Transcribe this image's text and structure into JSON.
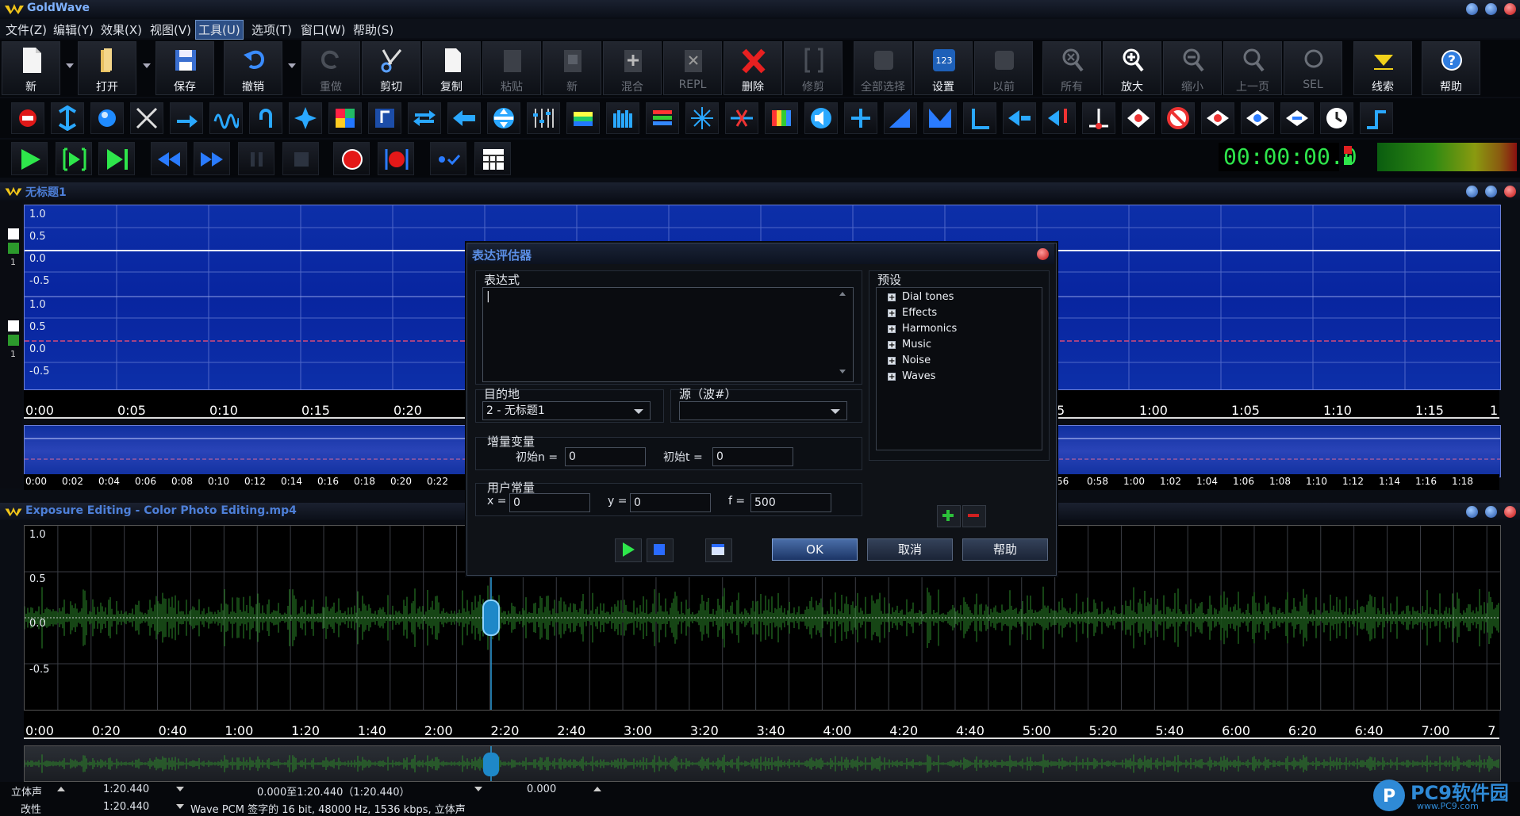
{
  "app": {
    "title": "GoldWave"
  },
  "menu": [
    "文件(Z)",
    "编辑(Y)",
    "效果(X)",
    "视图(V)",
    "工具(U)",
    "选项(T)",
    "窗口(W)",
    "帮助(S)"
  ],
  "toolbar": {
    "new": "新",
    "open": "打开",
    "save": "保存",
    "undo": "撤销",
    "redo": "重做",
    "cut": "剪切",
    "copy": "复制",
    "paste": "粘贴",
    "paste_new": "新",
    "mix": "混合",
    "replace": "REPL",
    "delete": "删除",
    "trim": "修剪",
    "select_all": "全部选择",
    "settings": "设置",
    "previous": "以前",
    "all": "所有",
    "zoom_in": "放大",
    "zoom_out": "缩小",
    "prev_page": "上一页",
    "sel": "SEL",
    "cue": "线索",
    "help": "帮助",
    "settings_badge": "123"
  },
  "transport": {
    "time": "00:00:00.0"
  },
  "wave1": {
    "title": "无标题1",
    "y_labels": [
      "1.0",
      "0.5",
      "0.0",
      "-0.5"
    ],
    "ch_num": "1",
    "time_ticks": [
      "0:00",
      "0:05",
      "0:10",
      "0:15",
      "0:20",
      "5",
      "1:00",
      "1:05",
      "1:10",
      "1:15",
      "1"
    ],
    "overview_ticks": [
      "0:00",
      "0:02",
      "0:04",
      "0:06",
      "0:08",
      "0:10",
      "0:12",
      "0:14",
      "0:16",
      "0:18",
      "0:20",
      "0:22",
      ":56",
      "0:58",
      "1:00",
      "1:02",
      "1:04",
      "1:06",
      "1:08",
      "1:10",
      "1:12",
      "1:14",
      "1:16",
      "1:18"
    ]
  },
  "wave2": {
    "title": "Exposure Editing - Color Photo Editing.mp4",
    "y_labels": [
      "1.0",
      "0.5",
      "0.0",
      "-0.5"
    ],
    "time_ticks": [
      "0:00",
      "0:20",
      "0:40",
      "1:00",
      "1:20",
      "1:40",
      "2:00",
      "2:20",
      "2:40",
      "3:00",
      "3:20",
      "3:40",
      "4:00",
      "4:20",
      "4:40",
      "5:00",
      "5:20",
      "5:40",
      "6:00",
      "6:20",
      "6:40",
      "7:00",
      "7"
    ]
  },
  "dialog": {
    "title": "表达评估器",
    "expression_label": "表达式",
    "expression_value": "|",
    "destination_label": "目的地",
    "destination_value": "2 - 无标题1",
    "source_label": "源（波#）",
    "source_value": "",
    "increment_label": "增量变量",
    "init_n_label": "初始n =",
    "init_n_value": "0",
    "init_t_label": "初始t =",
    "init_t_value": "0",
    "user_const_label": "用户常量",
    "x_label": "x =",
    "x_value": "0",
    "y_label": "y =",
    "y_value": "0",
    "f_label": "f =",
    "f_value": "500",
    "presets_label": "预设",
    "presets": [
      "Dial tones",
      "Effects",
      "Harmonics",
      "Music",
      "Noise",
      "Waves"
    ],
    "ok": "OK",
    "cancel": "取消",
    "help": "帮助"
  },
  "status": {
    "channel": "立体声",
    "length": "1:20.440",
    "selection": "0.000至1:20.440（1:20.440）",
    "position": "0.000",
    "modified": "改性",
    "length2": "1:20.440",
    "format": "Wave PCM 签字的 16 bit, 48000 Hz, 1536 kbps, 立体声"
  },
  "watermark": {
    "text": "PC9软件园",
    "url": "www.PC9.com"
  }
}
